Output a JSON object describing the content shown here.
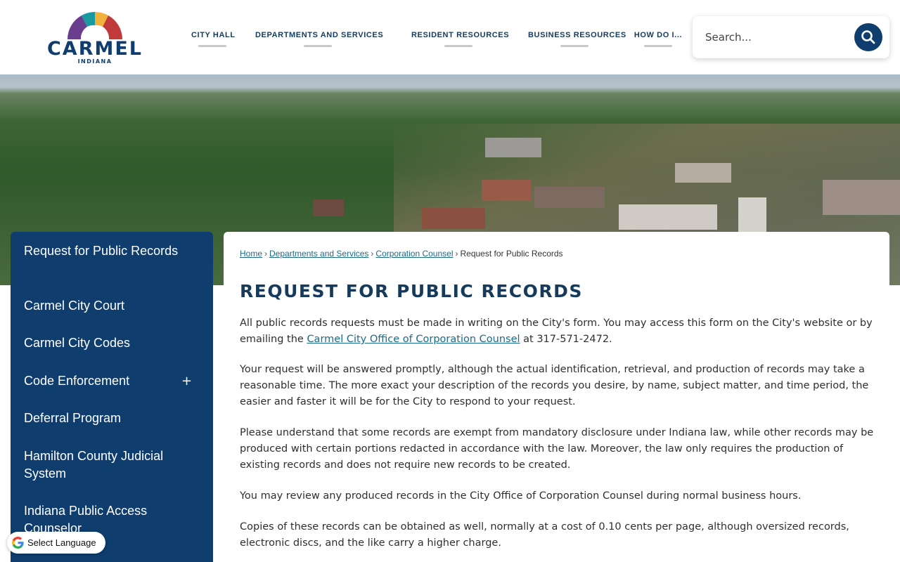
{
  "logo": {
    "name": "CARMEL",
    "state": "INDIANA"
  },
  "nav": {
    "items": [
      {
        "label": "CITY HALL"
      },
      {
        "label": "DEPARTMENTS AND SERVICES"
      },
      {
        "label": "RESIDENT RESOURCES"
      },
      {
        "label": "BUSINESS RESOURCES"
      },
      {
        "label": "HOW DO I..."
      }
    ]
  },
  "search": {
    "placeholder": "Search..."
  },
  "sidebar": {
    "items": [
      {
        "label": "Request for Public Records"
      },
      {
        "label": "Carmel City Court"
      },
      {
        "label": "Carmel City Codes"
      },
      {
        "label": "Code Enforcement"
      },
      {
        "label": "Deferral Program"
      },
      {
        "label": "Hamilton County Judicial System"
      },
      {
        "label": "Indiana Public Access Counselor"
      }
    ],
    "expand_symbol": "+"
  },
  "breadcrumb": {
    "items": [
      "Home",
      "Departments and Services",
      "Corporation Counsel"
    ],
    "current": "Request for Public Records",
    "separator": "›"
  },
  "page": {
    "title": "REQUEST FOR PUBLIC RECORDS",
    "p1_before": "All public records requests must be made in writing on the City's form. You may access this form on the City's website or by emailing the ",
    "p1_link": "Carmel City Office of Corporation Counsel",
    "p1_after": " at 317-571-2472.",
    "p2": "Your request will be answered promptly, although the actual identification, retrieval, and production of records may take a reasonable time. The more exact your description of the records you desire, by name, subject matter, and time period, the easier and faster it will be for the City to respond to your request.",
    "p3": "Please understand that some records are exempt from mandatory disclosure under Indiana law, while other records may be produced with certain portions redacted in accordance with the law. Moreover, the law only requires the production of existing records and does not require new records to be created.",
    "p4": "You may review any produced records in the City Office of Corporation Counsel during normal business hours.",
    "p5": "Copies of these records can be obtained as well, normally at a cost of 0.10 cents per page, although oversized records, electronic discs, and the like carry a higher charge."
  },
  "translate": {
    "label": "Select Language"
  },
  "colors": {
    "brand_navy": "#0e3d6e",
    "link": "#1a6b8c"
  }
}
